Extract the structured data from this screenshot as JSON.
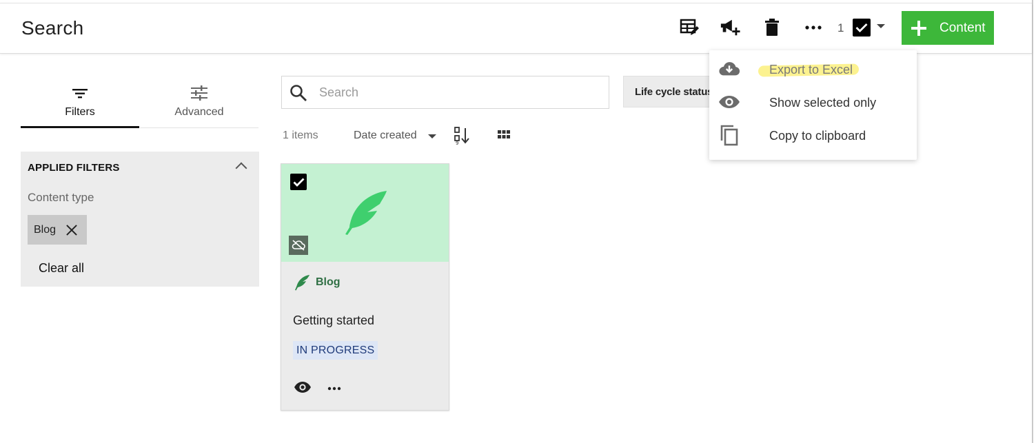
{
  "header": {
    "title": "Search",
    "toolbar_icons": [
      "edit-table-icon",
      "megaphone-add-icon",
      "trash-icon",
      "more-horizontal-icon"
    ],
    "selected_count": "1",
    "create_button_label": "Content",
    "accent_color": "#3db73a"
  },
  "dropdown_menu": {
    "items": [
      {
        "label": "Export to Excel",
        "icon": "cloud-download-icon",
        "highlighted": true
      },
      {
        "label": "Show selected only",
        "icon": "eye-icon"
      },
      {
        "label": "Copy to clipboard",
        "icon": "copy-icon"
      }
    ]
  },
  "sidebar": {
    "tabs": [
      {
        "label": "Filters",
        "icon": "filter-icon",
        "active": true
      },
      {
        "label": "Advanced",
        "icon": "sliders-icon",
        "active": false
      }
    ],
    "applied_filters": {
      "title": "APPLIED FILTERS",
      "group_label": "Content type",
      "chips": [
        {
          "label": "Blog"
        }
      ],
      "clear_all_label": "Clear all"
    }
  },
  "search": {
    "placeholder": "Search",
    "value": "",
    "lifecycle_label": "Life cycle status"
  },
  "results": {
    "items_count": "1 items",
    "sort_label": "Date created",
    "cards": [
      {
        "selected": true,
        "type_label": "Blog",
        "title": "Getting started",
        "status": "IN PROGRESS",
        "thumb_color": "#c4f1d2",
        "status_color": "#dde6f6"
      }
    ]
  }
}
